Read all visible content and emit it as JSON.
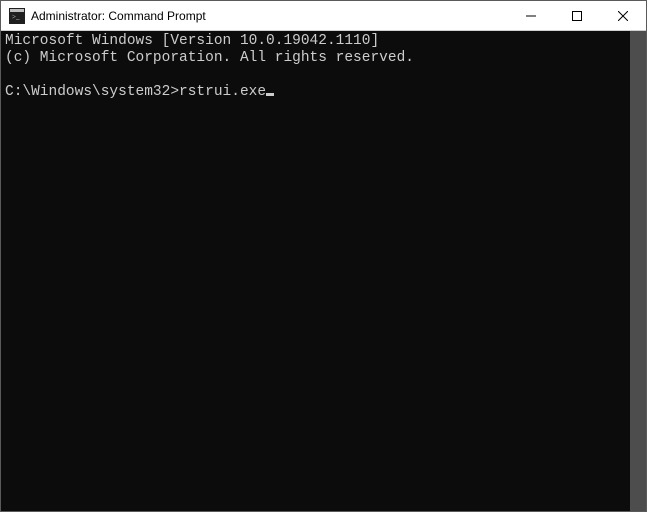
{
  "window": {
    "title": "Administrator: Command Prompt"
  },
  "terminal": {
    "line1": "Microsoft Windows [Version 10.0.19042.1110]",
    "line2": "(c) Microsoft Corporation. All rights reserved.",
    "blank": "",
    "prompt": "C:\\Windows\\system32>",
    "command": "rstrui.exe"
  }
}
